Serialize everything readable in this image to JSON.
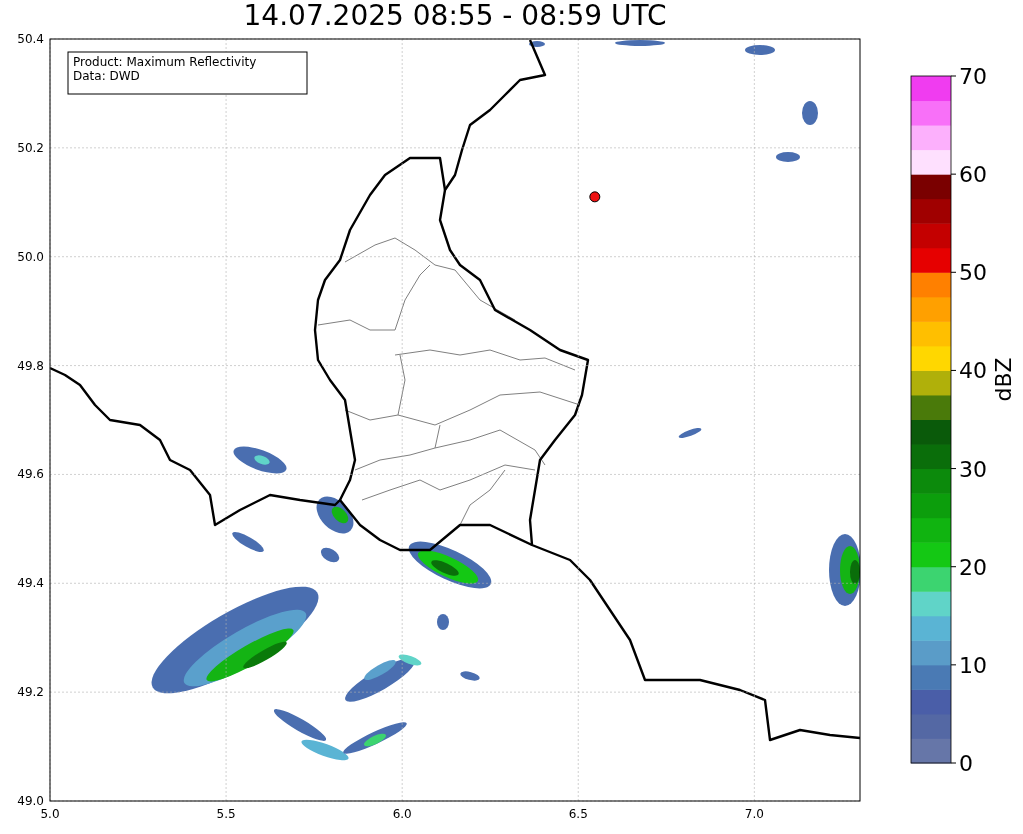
{
  "chart_data": {
    "type": "scatter",
    "title": "14.07.2025 08:55 - 08:59 UTC",
    "xlim": [
      5.0,
      7.3
    ],
    "ylim": [
      49.0,
      50.4
    ],
    "xticks": [
      {
        "value": 5.0,
        "label": "5.0"
      },
      {
        "value": 5.5,
        "label": "5.5"
      },
      {
        "value": 6.0,
        "label": "6.0"
      },
      {
        "value": 6.5,
        "label": "6.5"
      },
      {
        "value": 7.0,
        "label": "7.0"
      }
    ],
    "yticks": [
      {
        "value": 49.0,
        "label": "49.0"
      },
      {
        "value": 49.2,
        "label": "49.2"
      },
      {
        "value": 49.4,
        "label": "49.4"
      },
      {
        "value": 49.6,
        "label": "49.6"
      },
      {
        "value": 49.8,
        "label": "49.8"
      },
      {
        "value": 50.0,
        "label": "50.0"
      },
      {
        "value": 50.2,
        "label": "50.2"
      },
      {
        "value": 50.4,
        "label": "50.4"
      }
    ],
    "x": [
      6.547
    ],
    "series": [
      {
        "color": "#ee1111",
        "values": [
          50.11
        ]
      }
    ],
    "annotations": [
      "Product: Maximum Reflectivity",
      "Data: DWD"
    ],
    "grid": true
  },
  "colorbar": {
    "label": "dBZ",
    "ticks": [
      "70",
      "60",
      "50",
      "40",
      "30",
      "20",
      "10",
      "0"
    ],
    "bands": [
      {
        "color": "#6676a8"
      },
      {
        "color": "#5468a4"
      },
      {
        "color": "#4a5ea8"
      },
      {
        "color": "#4a7ab4"
      },
      {
        "color": "#5a9cc8"
      },
      {
        "color": "#5ab4d4"
      },
      {
        "color": "#60d4c8"
      },
      {
        "color": "#3cd470"
      },
      {
        "color": "#14c814"
      },
      {
        "color": "#10b410"
      },
      {
        "color": "#0c9e0c"
      },
      {
        "color": "#0c8a0c"
      },
      {
        "color": "#0a6e0a"
      },
      {
        "color": "#0a5a0a"
      },
      {
        "color": "#4a7a0a"
      },
      {
        "color": "#b0b00a"
      },
      {
        "color": "#ffd700"
      },
      {
        "color": "#ffbf00"
      },
      {
        "color": "#ffa000"
      },
      {
        "color": "#ff8000"
      },
      {
        "color": "#e60000"
      },
      {
        "color": "#c40000"
      },
      {
        "color": "#a00000"
      },
      {
        "color": "#7a0000"
      },
      {
        "color": "#fee0fe"
      },
      {
        "color": "#fcb0fc"
      },
      {
        "color": "#f870f8"
      },
      {
        "color": "#f03cf0"
      }
    ]
  }
}
